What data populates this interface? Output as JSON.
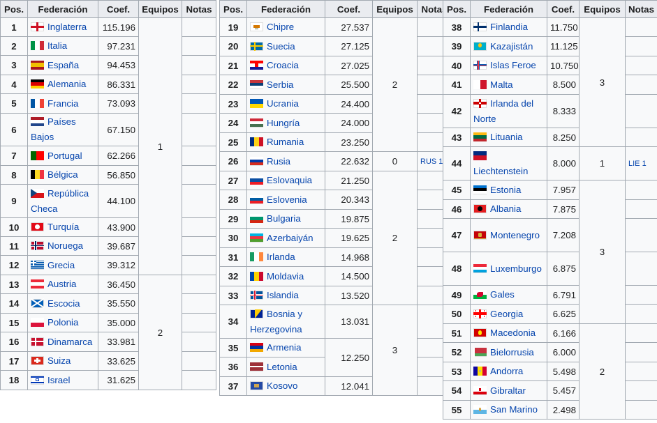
{
  "headers": {
    "pos": "Pos.",
    "fed": "Federación",
    "coef": "Coef.",
    "equipos": "Equipos",
    "notas": "Notas"
  },
  "tables": [
    {
      "rows": [
        {
          "pos": "1",
          "name": "Inglaterra",
          "coef": "115.196",
          "flag": "england",
          "h": 27
        },
        {
          "pos": "2",
          "name": "Italia",
          "coef": "97.231",
          "flag": "italy",
          "h": 27
        },
        {
          "pos": "3",
          "name": "España",
          "coef": "94.453",
          "flag": "spain",
          "h": 28
        },
        {
          "pos": "4",
          "name": "Alemania",
          "coef": "86.331",
          "flag": "germany",
          "h": 27
        },
        {
          "pos": "5",
          "name": "Francia",
          "coef": "73.093",
          "flag": "france",
          "h": 28
        },
        {
          "pos": "6",
          "name": "Países Bajos",
          "coef": "67.150",
          "flag": "netherlands",
          "h": 47
        },
        {
          "pos": "7",
          "name": "Portugal",
          "coef": "62.266",
          "flag": "portugal",
          "h": 28
        },
        {
          "pos": "8",
          "name": "Bélgica",
          "coef": "56.850",
          "flag": "belgium",
          "h": 27
        },
        {
          "pos": "9",
          "name": "República Checa",
          "coef": "44.100",
          "flag": "czech",
          "h": 48
        },
        {
          "pos": "10",
          "name": "Turquía",
          "coef": "43.900",
          "flag": "turkey",
          "h": 27
        },
        {
          "pos": "11",
          "name": "Noruega",
          "coef": "39.687",
          "flag": "norway",
          "h": 27
        },
        {
          "pos": "12",
          "name": "Grecia",
          "coef": "39.312",
          "flag": "greece",
          "h": 28
        },
        {
          "pos": "13",
          "name": "Austria",
          "coef": "36.450",
          "flag": "austria",
          "h": 27
        },
        {
          "pos": "14",
          "name": "Escocia",
          "coef": "35.550",
          "flag": "scotland",
          "h": 28
        },
        {
          "pos": "15",
          "name": "Polonia",
          "coef": "35.000",
          "flag": "poland",
          "h": 27
        },
        {
          "pos": "16",
          "name": "Dinamarca",
          "coef": "33.981",
          "flag": "denmark",
          "h": 28
        },
        {
          "pos": "17",
          "name": "Suiza",
          "coef": "33.625",
          "flag": "switzerland",
          "h": 27
        },
        {
          "pos": "18",
          "name": "Israel",
          "coef": "31.625",
          "flag": "israel",
          "h": 28
        }
      ],
      "groups": [
        {
          "label": "1",
          "start": 0,
          "span": 12
        },
        {
          "label": "2",
          "start": 12,
          "span": 6
        }
      ],
      "notes": {}
    },
    {
      "rows": [
        {
          "pos": "19",
          "name": "Chipre",
          "coef": "27.537",
          "flag": "cyprus",
          "h": 27
        },
        {
          "pos": "20",
          "name": "Suecia",
          "coef": "27.125",
          "flag": "sweden",
          "h": 28
        },
        {
          "pos": "21",
          "name": "Croacia",
          "coef": "27.025",
          "flag": "croatia",
          "h": 27
        },
        {
          "pos": "22",
          "name": "Serbia",
          "coef": "25.500",
          "flag": "serbia",
          "h": 28
        },
        {
          "pos": "23",
          "name": "Ucrania",
          "coef": "24.400",
          "flag": "ukraine",
          "h": 27
        },
        {
          "pos": "24",
          "name": "Hungría",
          "coef": "24.000",
          "flag": "hungary",
          "h": 28
        },
        {
          "pos": "25",
          "name": "Rumania",
          "coef": "23.250",
          "flag": "romania",
          "h": 27
        },
        {
          "pos": "26",
          "name": "Rusia",
          "coef": "22.632",
          "flag": "russia",
          "h": 28
        },
        {
          "pos": "27",
          "name": "Eslovaquia",
          "coef": "21.250",
          "flag": "slovakia",
          "h": 27
        },
        {
          "pos": "28",
          "name": "Eslovenia",
          "coef": "20.343",
          "flag": "slovenia",
          "h": 28
        },
        {
          "pos": "29",
          "name": "Bulgaria",
          "coef": "19.875",
          "flag": "bulgaria",
          "h": 27
        },
        {
          "pos": "30",
          "name": "Azerbaiyán",
          "coef": "19.625",
          "flag": "azerbaijan",
          "h": 28
        },
        {
          "pos": "31",
          "name": "Irlanda",
          "coef": "14.968",
          "flag": "ireland",
          "h": 27
        },
        {
          "pos": "32",
          "name": "Moldavia",
          "coef": "14.500",
          "flag": "moldova",
          "h": 28
        },
        {
          "pos": "33",
          "name": "Islandia",
          "coef": "13.520",
          "flag": "iceland",
          "h": 27
        },
        {
          "pos": "34",
          "name": "Bosnia y Herzegovina",
          "coef": "13.031",
          "flag": "bosnia",
          "h": 48
        },
        {
          "pos": "35",
          "name": "Armenia",
          "coef": "",
          "flag": "armenia",
          "h": 27
        },
        {
          "pos": "36",
          "name": "Letonia",
          "coef": "",
          "flag": "latvia",
          "h": 28
        },
        {
          "pos": "37",
          "name": "Kosovo",
          "coef": "12.041",
          "flag": "kosovo",
          "h": 27
        }
      ],
      "groups": [
        {
          "label": "2",
          "start": 0,
          "span": 7
        },
        {
          "label": "0",
          "start": 7,
          "span": 1
        },
        {
          "label": "2",
          "start": 8,
          "span": 7
        },
        {
          "label": "3",
          "start": 15,
          "span": 4
        }
      ],
      "merged_coef": [
        {
          "start": 16,
          "span": 2,
          "value": "12.250"
        }
      ],
      "notes": {
        "7": "RUS 1"
      }
    },
    {
      "rows": [
        {
          "pos": "38",
          "name": "Finlandia",
          "coef": "11.750",
          "flag": "finland",
          "h": 27
        },
        {
          "pos": "39",
          "name": "Kazajistán",
          "coef": "11.125",
          "flag": "kazakhstan",
          "h": 28
        },
        {
          "pos": "40",
          "name": "Islas Feroe",
          "coef": "10.750",
          "flag": "faroe",
          "h": 27
        },
        {
          "pos": "41",
          "name": "Malta",
          "coef": "8.500",
          "flag": "malta",
          "h": 28
        },
        {
          "pos": "42",
          "name": "Irlanda del Norte",
          "coef": "8.333",
          "flag": "nireland",
          "h": 48
        },
        {
          "pos": "43",
          "name": "Lituania",
          "coef": "8.250",
          "flag": "lithuania",
          "h": 27
        },
        {
          "pos": "44",
          "name": "Liechtenstein",
          "coef": "8.000",
          "flag": "liechtenstein",
          "h": 48
        },
        {
          "pos": "45",
          "name": "Estonia",
          "coef": "7.957",
          "flag": "estonia",
          "h": 28
        },
        {
          "pos": "46",
          "name": "Albania",
          "coef": "7.875",
          "flag": "albania",
          "h": 27
        },
        {
          "pos": "47",
          "name": "Montenegro",
          "coef": "7.208",
          "flag": "montenegro",
          "h": 48
        },
        {
          "pos": "48",
          "name": "Luxemburgo",
          "coef": "6.875",
          "flag": "luxembourg",
          "h": 48
        },
        {
          "pos": "49",
          "name": "Gales",
          "coef": "6.791",
          "flag": "wales",
          "h": 27
        },
        {
          "pos": "50",
          "name": "Georgia",
          "coef": "6.625",
          "flag": "georgia",
          "h": 28
        },
        {
          "pos": "51",
          "name": "Macedonia",
          "coef": "6.166",
          "flag": "macedonia",
          "h": 27
        },
        {
          "pos": "52",
          "name": "Bielorrusia",
          "coef": "6.000",
          "flag": "belarus",
          "h": 28
        },
        {
          "pos": "53",
          "name": "Andorra",
          "coef": "5.498",
          "flag": "andorra",
          "h": 27
        },
        {
          "pos": "54",
          "name": "Gibraltar",
          "coef": "5.457",
          "flag": "gibraltar",
          "h": 28
        },
        {
          "pos": "55",
          "name": "San Marino",
          "coef": "2.498",
          "flag": "sanmarino",
          "h": 27
        }
      ],
      "groups": [
        {
          "label": "3",
          "start": 0,
          "span": 6
        },
        {
          "label": "1",
          "start": 6,
          "span": 1
        },
        {
          "label": "3",
          "start": 7,
          "span": 6
        },
        {
          "label": "2",
          "start": 13,
          "span": 5
        }
      ],
      "notes": {
        "6": "LIE 1"
      }
    }
  ],
  "flags": {
    "england": "#ce1124",
    "italy": [
      "#009246",
      "#ffffff",
      "#ce2b37"
    ],
    "spain": [
      "#aa151b",
      "#f1bf00",
      "#aa151b"
    ],
    "germany": [
      "#000000",
      "#dd0000",
      "#ffce00"
    ],
    "france": [
      "#0055a4",
      "#ffffff",
      "#ef4135"
    ],
    "netherlands": [
      "#ae1c28",
      "#ffffff",
      "#21468b"
    ],
    "portugal": [
      "#006600",
      "#ff0000"
    ],
    "belgium": [
      "#000000",
      "#fdda24",
      "#ef3340"
    ],
    "czech": [
      "#ffffff",
      "#d7141a",
      "#11457e"
    ],
    "turkey": "#e30a17",
    "norway": [
      "#ba0c2f",
      "#ffffff",
      "#00205b"
    ],
    "greece": [
      "#0d5eaf",
      "#ffffff"
    ],
    "austria": [
      "#ed2939",
      "#ffffff",
      "#ed2939"
    ],
    "scotland": [
      "#005eb8",
      "#ffffff"
    ],
    "poland": [
      "#ffffff",
      "#dc143c"
    ],
    "denmark": [
      "#c8102e",
      "#ffffff"
    ],
    "switzerland": [
      "#da291c",
      "#ffffff"
    ],
    "israel": [
      "#ffffff",
      "#0038b8"
    ],
    "cyprus": [
      "#ffffff",
      "#d57800"
    ],
    "sweden": [
      "#006aa7",
      "#fecc00"
    ],
    "croatia": [
      "#ff0000",
      "#ffffff",
      "#171796"
    ],
    "serbia": [
      "#c6363c",
      "#0c4076",
      "#ffffff"
    ],
    "ukraine": [
      "#0057b7",
      "#ffd700"
    ],
    "hungary": [
      "#ce2939",
      "#ffffff",
      "#477050"
    ],
    "romania": [
      "#002b7f",
      "#fcd116",
      "#ce1126"
    ],
    "russia": [
      "#ffffff",
      "#0039a6",
      "#d52b1e"
    ],
    "slovakia": [
      "#ffffff",
      "#0b4ea2",
      "#ee1c25"
    ],
    "slovenia": [
      "#ffffff",
      "#005da4",
      "#ed1c24"
    ],
    "bulgaria": [
      "#ffffff",
      "#00966e",
      "#d62612"
    ],
    "azerbaijan": [
      "#00b5e2",
      "#ef3340",
      "#509e2f"
    ],
    "ireland": [
      "#169b62",
      "#ffffff",
      "#ff883e"
    ],
    "moldova": [
      "#0046ae",
      "#ffd200",
      "#cc092f"
    ],
    "iceland": [
      "#02529c",
      "#ffffff",
      "#dc1e35"
    ],
    "bosnia": [
      "#002395",
      "#fecb00"
    ],
    "armenia": [
      "#d90012",
      "#0033a0",
      "#f2a800"
    ],
    "latvia": [
      "#9e3039",
      "#ffffff",
      "#9e3039"
    ],
    "kosovo": [
      "#244aa5",
      "#d0a650"
    ],
    "finland": [
      "#ffffff",
      "#002f6c"
    ],
    "kazakhstan": [
      "#00afca",
      "#fec50c"
    ],
    "faroe": [
      "#ffffff",
      "#005eb8",
      "#ef303e"
    ],
    "malta": [
      "#ffffff",
      "#cf142b"
    ],
    "nireland": [
      "#ffffff",
      "#cc0000"
    ],
    "lithuania": [
      "#fdb913",
      "#006a44",
      "#c1272d"
    ],
    "liechtenstein": [
      "#002b7f",
      "#ce1126"
    ],
    "estonia": [
      "#0072ce",
      "#000000",
      "#ffffff"
    ],
    "albania": "#e41e20",
    "montenegro": [
      "#c40308",
      "#d4af3a"
    ],
    "luxembourg": [
      "#ed2939",
      "#ffffff",
      "#00a1de"
    ],
    "wales": [
      "#ffffff",
      "#00b140",
      "#d30731"
    ],
    "georgia": [
      "#ffffff",
      "#ff0000"
    ],
    "macedonia": [
      "#d20000",
      "#ffe600"
    ],
    "belarus": [
      "#c8313e",
      "#4aa657"
    ],
    "andorra": [
      "#10069f",
      "#fedf00",
      "#d50032"
    ],
    "gibraltar": [
      "#ffffff",
      "#da000c"
    ],
    "sanmarino": [
      "#ffffff",
      "#5eb6e4"
    ]
  }
}
